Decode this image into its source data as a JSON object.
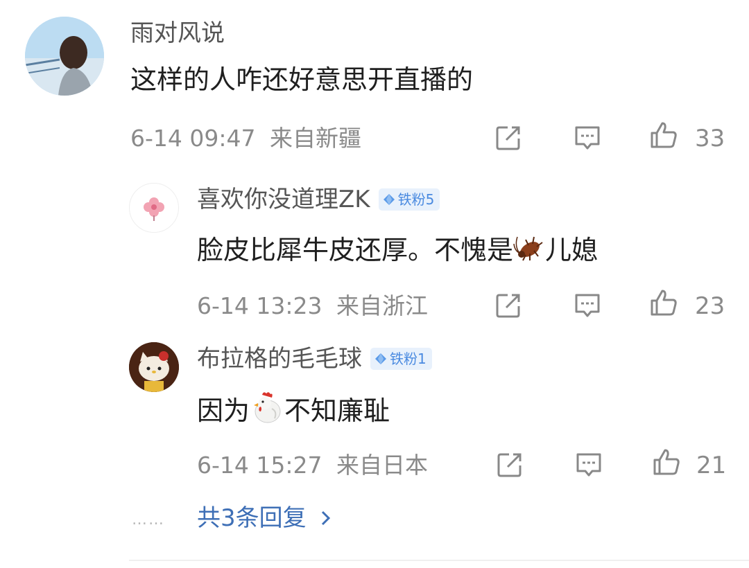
{
  "comment": {
    "username": "雨对风说",
    "text": "这样的人咋还好意思开直播的",
    "time": "6-14 09:47",
    "location": "来自新疆",
    "like_count": "33",
    "icons": {
      "share": "share-icon",
      "reply": "comment-icon",
      "like": "thumbs-up-icon"
    }
  },
  "replies": [
    {
      "username": "喜欢你没道理ZK",
      "badge": "铁粉5",
      "text_before": "脸皮比犀牛皮还厚。不愧是",
      "emoji": "cockroach-emoji",
      "text_after": "儿媳",
      "time": "6-14 13:23",
      "location": "来自浙江",
      "like_count": "23"
    },
    {
      "username": "布拉格的毛毛球",
      "badge": "铁粉1",
      "text_before": "因为",
      "emoji": "chicken-emoji",
      "text_after": "不知廉耻",
      "time": "6-14 15:27",
      "location": "来自日本",
      "like_count": "21"
    }
  ],
  "more_replies": {
    "dots": "……",
    "label": "共3条回复",
    "chevron": "chevron-right-icon"
  },
  "colors": {
    "link": "#3e6fb6",
    "badge_bg": "#e8f1fc",
    "badge_text": "#4a8ae0",
    "meta": "#8a8a8a"
  }
}
